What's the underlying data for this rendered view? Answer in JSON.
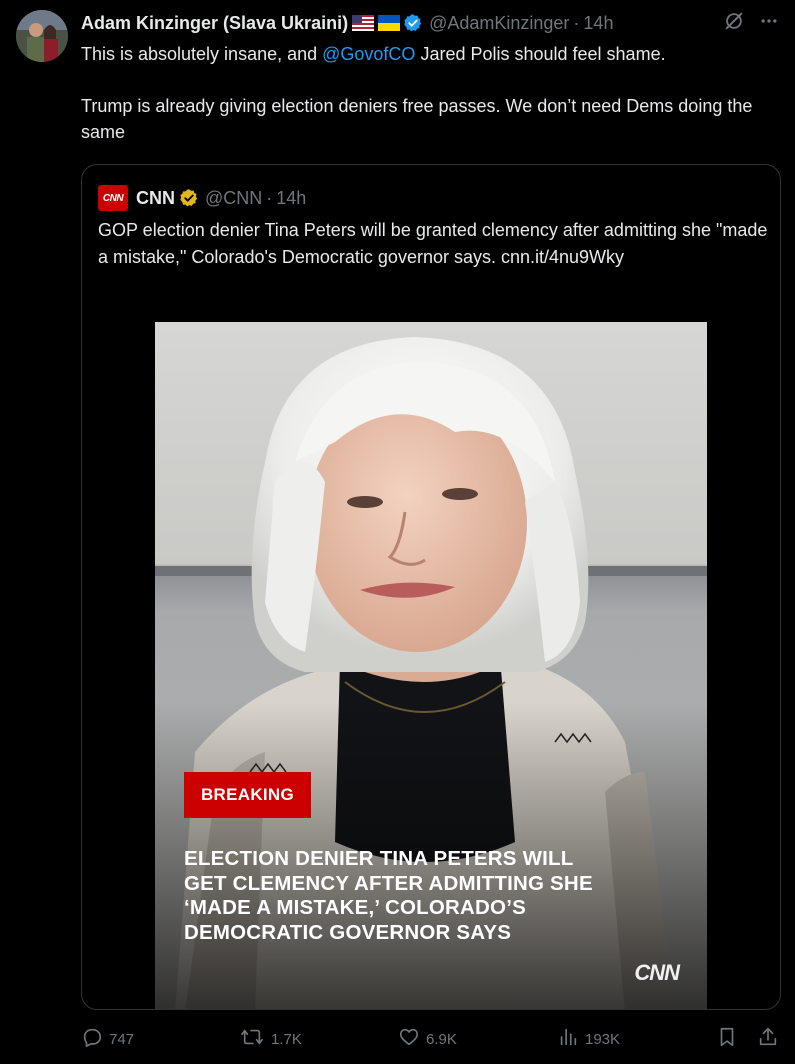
{
  "author": {
    "display_name": "Adam Kinzinger (Slava Ukraini)",
    "handle": "@AdamKinzinger",
    "separator": "·",
    "time": "14h",
    "flags": [
      "us-flag-icon",
      "ukraine-flag-icon"
    ],
    "verified": true
  },
  "tweet": {
    "line1_prefix": "This is absolutely insane, and ",
    "mention": "@GovofCO",
    "line1_suffix": " Jared Polis should feel shame.",
    "line2": "Trump is already giving election deniers free passes.  We don’t need Dems doing the same"
  },
  "quote": {
    "logo_text": "CNN",
    "name": "CNN",
    "handle": "@CNN",
    "separator": "·",
    "time": "14h",
    "text": "GOP election denier Tina Peters will be granted clemency after admitting she \"made a mistake,\" Colorado's Democratic governor says. cnn.it/4nu9Wky",
    "media": {
      "badge": "BREAKING",
      "headline_lines": [
        "ELECTION DENIER TINA PETERS WILL",
        "GET CLEMENCY AFTER ADMITTING SHE",
        "‘MADE A MISTAKE,’ COLORADO’S",
        "DEMOCRATIC GOVERNOR SAYS"
      ],
      "watermark": "CNN"
    }
  },
  "actions": {
    "replies": "747",
    "reposts": "1.7K",
    "likes": "6.9K",
    "views": "193K"
  },
  "colors": {
    "background": "#000000",
    "text": "#e7e9ea",
    "muted": "#71767b",
    "link": "#1d9bf0",
    "cnn_red": "#cc0000",
    "gold_badge": "#e2b719",
    "verified_blue": "#1d9bf0"
  }
}
